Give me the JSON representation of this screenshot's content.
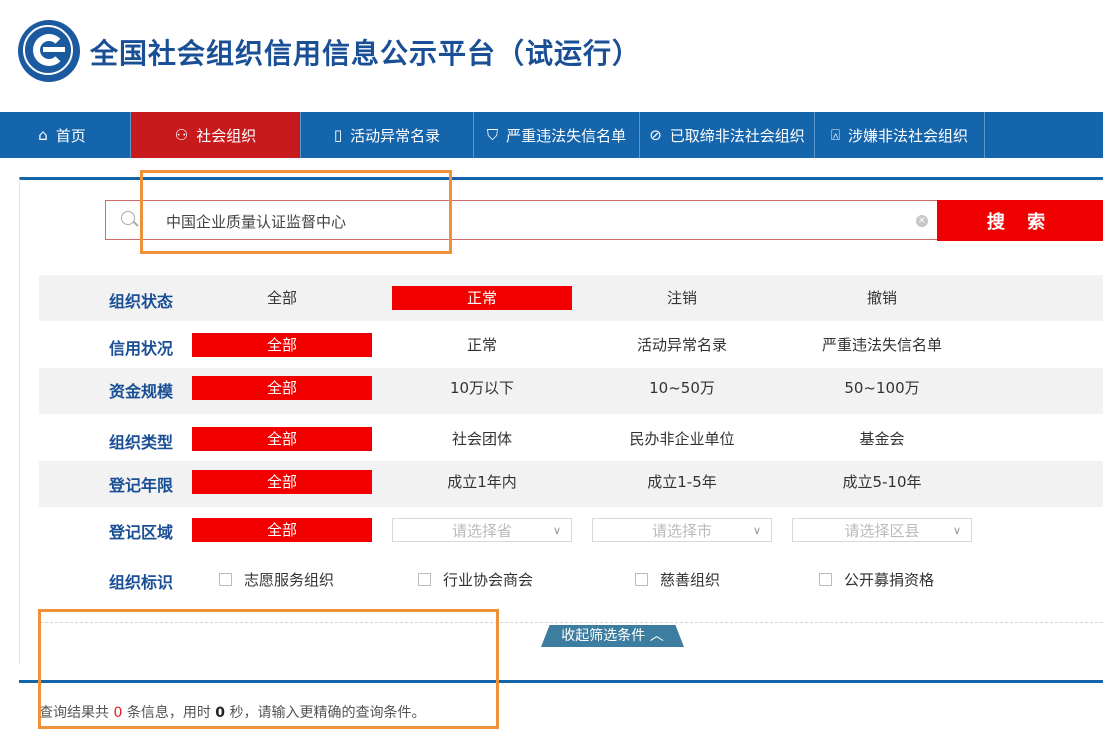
{
  "header": {
    "title": "全国社会组织信用信息公示平台（试运行）"
  },
  "nav": [
    {
      "label": "首页",
      "icon": "home-icon",
      "active": false
    },
    {
      "label": "社会组织",
      "icon": "org-tree-icon",
      "active": true
    },
    {
      "label": "活动异常名录",
      "icon": "clipboard-icon",
      "active": false
    },
    {
      "label": "严重违法失信名单",
      "icon": "shield-alert-icon",
      "active": false
    },
    {
      "label": "已取缔非法社会组织",
      "icon": "ban-icon",
      "active": false
    },
    {
      "label": "涉嫌非法社会组织",
      "icon": "alarm-icon",
      "active": false
    }
  ],
  "search": {
    "value": "中国企业质量认证监督中心",
    "button_label": "搜 索"
  },
  "filters": {
    "status": {
      "label": "组织状态",
      "options": [
        "全部",
        "正常",
        "注销",
        "撤销"
      ],
      "selected": "正常"
    },
    "credit": {
      "label": "信用状况",
      "options": [
        "全部",
        "正常",
        "活动异常名录",
        "严重违法失信名单"
      ],
      "selected": "全部"
    },
    "capital": {
      "label": "资金规模",
      "options": [
        "全部",
        "10万以下",
        "10~50万",
        "50~100万"
      ],
      "selected": "全部"
    },
    "type": {
      "label": "组织类型",
      "options": [
        "全部",
        "社会团体",
        "民办非企业单位",
        "基金会"
      ],
      "selected": "全部"
    },
    "years": {
      "label": "登记年限",
      "options": [
        "全部",
        "成立1年内",
        "成立1-5年",
        "成立5-10年"
      ],
      "selected": "全部"
    },
    "region": {
      "label": "登记区域",
      "all": "全部",
      "province_placeholder": "请选择省",
      "city_placeholder": "请选择市",
      "county_placeholder": "请选择区县"
    },
    "tags": {
      "label": "组织标识",
      "options": [
        "志愿服务组织",
        "行业协会商会",
        "慈善组织",
        "公开募捐资格"
      ]
    }
  },
  "collapse_label": "收起筛选条件",
  "result": {
    "prefix": "查询结果共",
    "count": "0",
    "mid": "条信息，用时",
    "seconds": "0",
    "suffix": "秒，请输入更精确的查询条件。"
  },
  "colors": {
    "brand_blue": "#1565ad",
    "active_red": "#c8191c",
    "select_red": "#f20000",
    "highlight_orange": "#f0913a"
  }
}
